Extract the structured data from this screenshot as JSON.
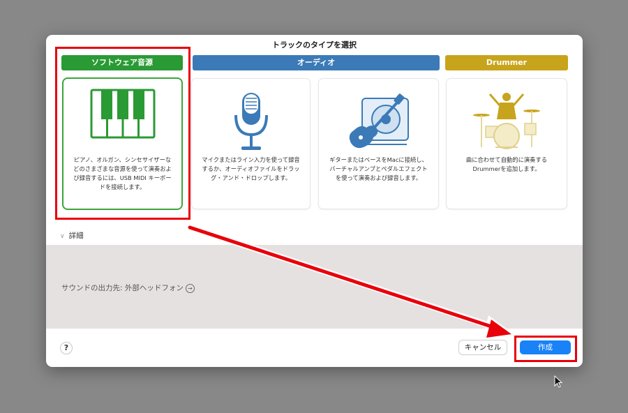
{
  "dialog": {
    "title": "トラックのタイプを選択",
    "categories": [
      {
        "label": "ソフトウェア音源",
        "color": "#2a9a34"
      },
      {
        "label": "オーディオ",
        "color": "#3b7ab7"
      },
      {
        "label": "Drummer",
        "color": "#c8a41c"
      }
    ],
    "cards": [
      {
        "icon": "piano-keyboard-icon",
        "description": "ピアノ、オルガン、シンセサイザーなどのさまざまな音源を使って演奏および録音するには、USB MIDI キーボードを接続します。",
        "selected": true
      },
      {
        "icon": "microphone-icon",
        "description": "マイクまたはライン入力を使って録音するか、オーディオファイルをドラッグ・アンド・ドロップします。",
        "selected": false
      },
      {
        "icon": "guitar-amp-icon",
        "description": "ギターまたはベースをMacに接続し、バーチャルアンプとペダルエフェクトを使って演奏および録音します。",
        "selected": false
      },
      {
        "icon": "drummer-icon",
        "description": "曲に合わせて自動的に演奏するDrummerを追加します。",
        "selected": false
      }
    ],
    "details_label": "詳細",
    "output_label": "サウンドの出力先: 外部ヘッドフォン",
    "help_label": "?",
    "cancel_label": "キャンセル",
    "create_label": "作成"
  },
  "colors": {
    "highlight_red": "#e8000b",
    "accent_blue": "#1a82f7",
    "panel_bg": "#e6e1e1"
  }
}
